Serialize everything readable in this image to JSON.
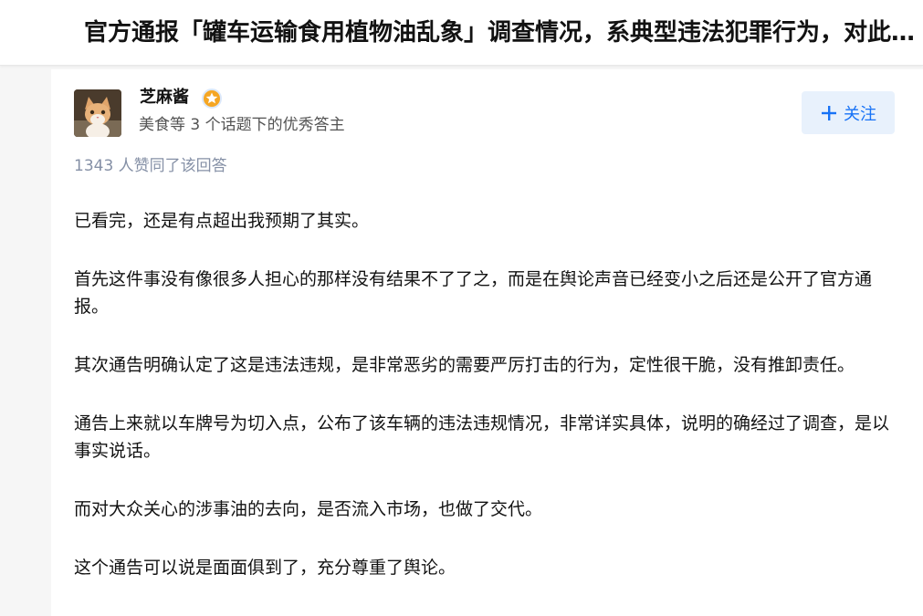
{
  "question": {
    "title": "官方通报「罐车运输食用植物油乱象」调查情况，系典型违法犯罪行为，对此你怎么看？"
  },
  "author": {
    "name": "芝麻酱",
    "headline": "美食等 3 个话题下的优秀答主",
    "badge_color": "#f5a623",
    "follow_label": "关注",
    "follow_icon": "plus-icon"
  },
  "answer": {
    "vote_summary": "1343 人赞同了该回答",
    "paragraphs": [
      "已看完，还是有点超出我预期了其实。",
      "首先这件事没有像很多人担心的那样没有结果不了了之，而是在舆论声音已经变小之后还是公开了官方通报。",
      "其次通告明确认定了这是违法违规，是非常恶劣的需要严厉打击的行为，定性很干脆，没有推卸责任。",
      "通告上来就以车牌号为切入点，公布了该车辆的违法违规情况，非常详实具体，说明的确经过了调查，是以事实说话。",
      "而对大众关心的涉事油的去向，是否流入市场，也做了交代。",
      "这个通告可以说是面面俱到了，充分尊重了舆论。"
    ]
  },
  "colors": {
    "accent": "#1772f6",
    "follow_bg": "#e8f1fc",
    "meta_text": "#8590a6"
  }
}
